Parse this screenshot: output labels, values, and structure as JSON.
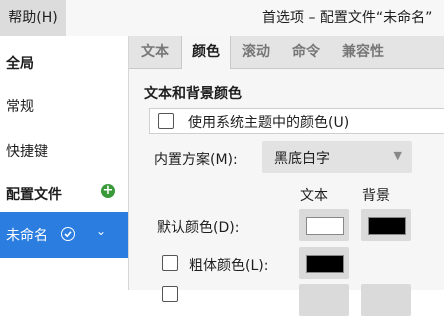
{
  "menubar": {
    "help": "帮助(H)",
    "title": "首选项 – 配置文件“未命名”"
  },
  "sidebar": {
    "global_header": "全局",
    "items": [
      {
        "label": "常规"
      },
      {
        "label": "快捷键"
      }
    ],
    "profiles_header": "配置文件",
    "add_icon": "+",
    "profiles": [
      {
        "label": "未命名",
        "default": true
      }
    ]
  },
  "tabs": [
    {
      "label": "文本",
      "active": false
    },
    {
      "label": "颜色",
      "active": true
    },
    {
      "label": "滚动",
      "active": false
    },
    {
      "label": "命令",
      "active": false
    },
    {
      "label": "兼容性",
      "active": false
    }
  ],
  "colors": {
    "section_title": "文本和背景颜色",
    "use_system_theme": {
      "label": "使用系统主题中的颜色(U)",
      "checked": false
    },
    "scheme_label": "内置方案(M):",
    "scheme_value": "黑底白字",
    "col_text": "文本",
    "col_background": "背景",
    "default_label": "默认颜色(D):",
    "default_text_color": "#ffffff",
    "default_bg_color": "#000000",
    "bold_label": "粗体颜色(L):",
    "bold_checked": false,
    "bold_color": "#000000"
  },
  "theme": {
    "accent": "#2b7de0",
    "add_icon_color": "#3a9a3a"
  }
}
